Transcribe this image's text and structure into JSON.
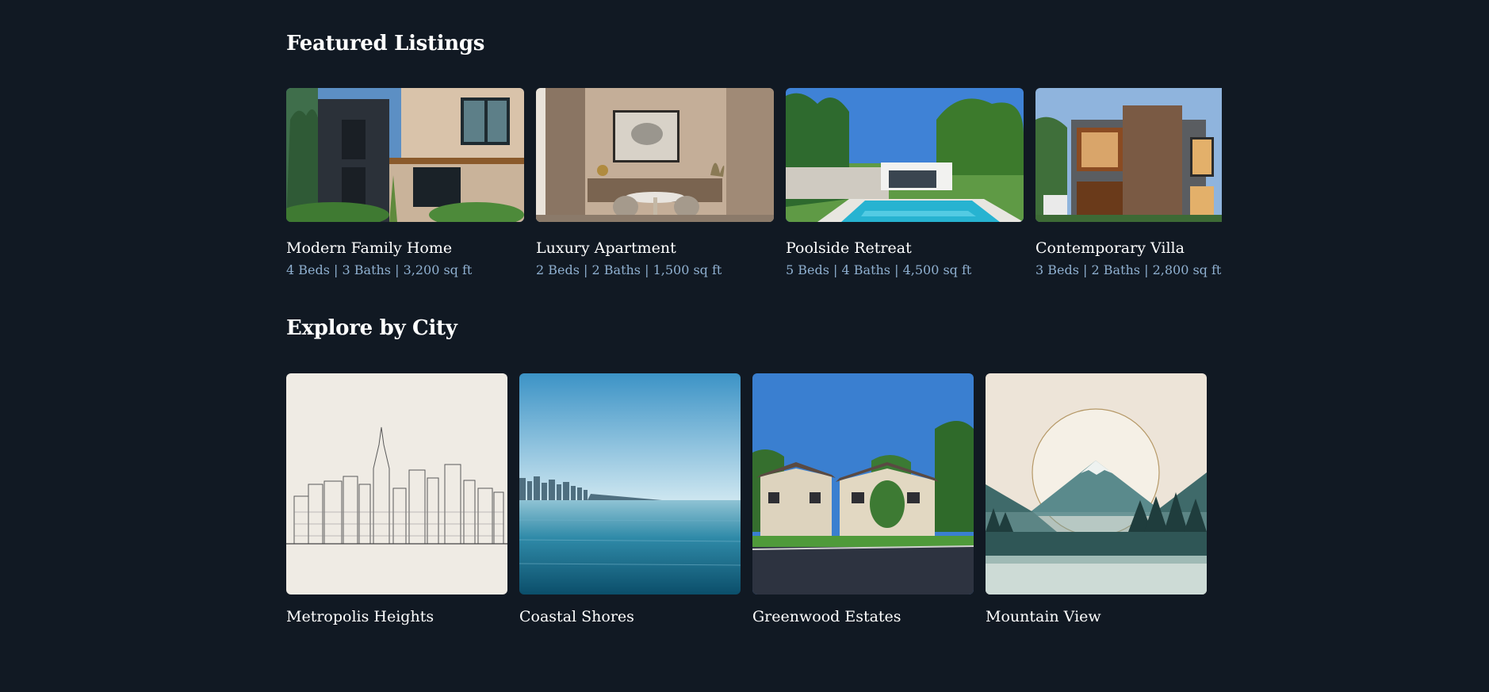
{
  "featured": {
    "title": "Featured Listings",
    "listings": [
      {
        "name": "Modern Family Home",
        "details": "4 Beds | 3 Baths | 3,200 sq ft",
        "image": "modern-family-home-photo"
      },
      {
        "name": "Luxury Apartment",
        "details": "2 Beds | 2 Baths | 1,500 sq ft",
        "image": "luxury-apartment-photo"
      },
      {
        "name": "Poolside Retreat",
        "details": "5 Beds | 4 Baths | 4,500 sq ft",
        "image": "poolside-retreat-photo"
      },
      {
        "name": "Contemporary Villa",
        "details": "3 Beds | 2 Baths | 2,800 sq ft",
        "image": "contemporary-villa-photo"
      }
    ]
  },
  "cities": {
    "title": "Explore by City",
    "items": [
      {
        "name": "Metropolis Heights",
        "image": "skyline-sketch-illustration"
      },
      {
        "name": "Coastal Shores",
        "image": "coastal-water-photo"
      },
      {
        "name": "Greenwood Estates",
        "image": "suburban-houses-photo"
      },
      {
        "name": "Mountain View",
        "image": "mountain-illustration"
      }
    ]
  },
  "colors": {
    "background": "#111923",
    "heading": "#ffffff",
    "meta_text": "#8fb0d0"
  }
}
